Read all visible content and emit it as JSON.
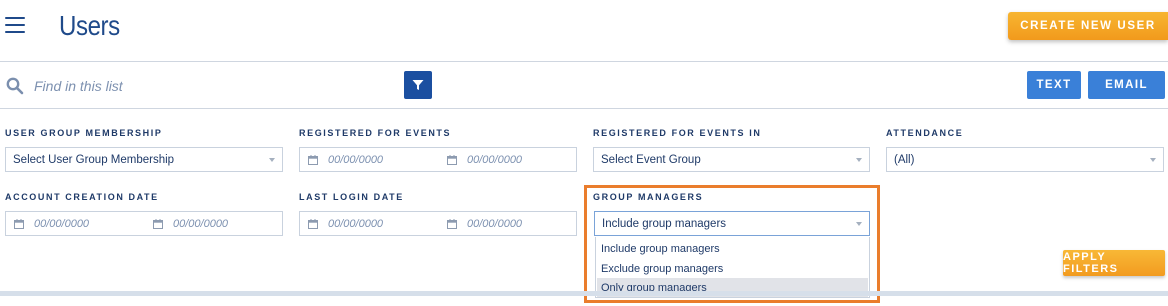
{
  "header": {
    "title": "Users",
    "create_button": "CREATE NEW USER"
  },
  "search": {
    "placeholder": "Find in this list",
    "text_button": "TEXT",
    "email_button": "EMAIL"
  },
  "filters": {
    "user_group_membership": {
      "label": "USER GROUP MEMBERSHIP",
      "value": "Select User Group Membership"
    },
    "registered_for_events": {
      "label": "REGISTERED FOR EVENTS",
      "from": "00/00/0000",
      "to": "00/00/0000"
    },
    "registered_for_events_in": {
      "label": "REGISTERED FOR EVENTS IN",
      "value": "Select Event Group"
    },
    "attendance": {
      "label": "ATTENDANCE",
      "value": "(All)"
    },
    "account_creation_date": {
      "label": "ACCOUNT CREATION DATE",
      "from": "00/00/0000",
      "to": "00/00/0000"
    },
    "last_login_date": {
      "label": "LAST LOGIN DATE",
      "from": "00/00/0000",
      "to": "00/00/0000"
    },
    "group_managers": {
      "label": "GROUP MANAGERS",
      "value": "Include group managers",
      "options": [
        "Include group managers",
        "Exclude group managers",
        "Only group managers"
      ]
    },
    "apply_button": "APPLY FILTERS"
  },
  "colors": {
    "accent_orange": "#f29a1c",
    "primary_blue": "#1b4fa0",
    "button_blue": "#3a80d8",
    "highlight_outline": "#ea7d2c"
  }
}
